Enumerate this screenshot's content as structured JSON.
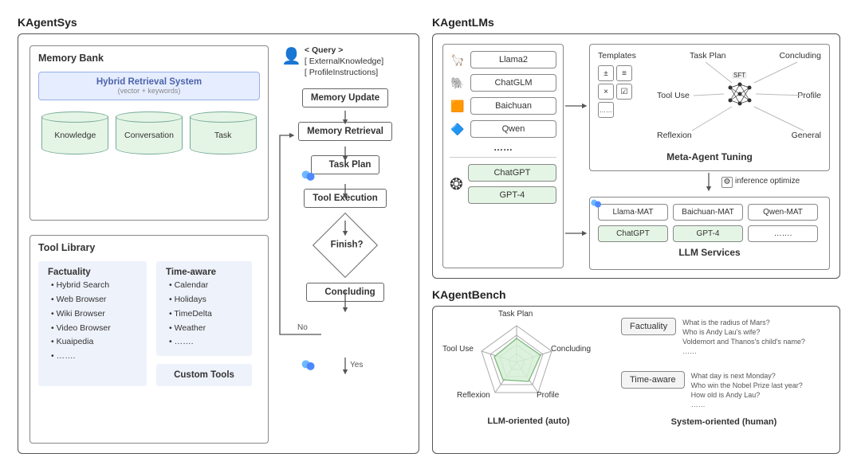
{
  "left": {
    "title": "KAgentSys",
    "memory_bank_title": "Memory Bank",
    "hybrid_retrieval_title": "Hybrid Retrieval System",
    "hybrid_retrieval_sub": "(vector + keywords)",
    "cyl1": "Knowledge",
    "cyl2": "Conversation",
    "cyl3": "Task",
    "tool_library_title": "Tool Library",
    "factuality_header": "Factuality",
    "factuality_items": [
      "Hybrid Search",
      "Web Browser",
      "Wiki Browser",
      "Video Browser",
      "Kuaipedia",
      "……."
    ],
    "timeaware_header": "Time-aware",
    "timeaware_items": [
      "Calendar",
      "Holidays",
      "TimeDelta",
      "Weather",
      "……."
    ],
    "custom_tools": "Custom Tools",
    "query": "< Query >",
    "ext_knowledge": "[ ExternalKnowledge]",
    "profile_inst": "[ ProfileInstructions]",
    "flow": {
      "memory_update": "Memory Update",
      "memory_retrieval": "Memory Retrieval",
      "task_plan": "Task Plan",
      "tool_execution": "Tool Execution",
      "finish": "Finish?",
      "no": "No",
      "yes": "Yes",
      "concluding": "Concluding"
    }
  },
  "lms": {
    "title": "KAgentLMs",
    "open_models": [
      "Llama2",
      "ChatGLM",
      "Baichuan",
      "Qwen"
    ],
    "dots": "……",
    "closed_models": [
      "ChatGPT",
      "GPT-4"
    ],
    "tuning": {
      "templates": "Templates",
      "task_plan": "Task Plan",
      "concluding": "Concluding",
      "tool_use": "Tool Use",
      "profile": "Profile",
      "reflexion": "Reflexion",
      "general": "General",
      "sft": "SFT",
      "footer": "Meta-Agent Tuning"
    },
    "inference_note": "inference optimize",
    "services": {
      "items": [
        "Llama-MAT",
        "Baichuan-MAT",
        "Qwen-MAT",
        "ChatGPT",
        "GPT-4",
        "……."
      ],
      "footer": "LLM Services"
    }
  },
  "bench": {
    "title": "KAgentBench",
    "radar_labels": [
      "Task Plan",
      "Concluding",
      "Profile",
      "Reflexion",
      "Tool Use"
    ],
    "left_caption": "LLM-oriented  (auto)",
    "right_caption": "System-oriented  (human)",
    "factuality_label": "Factuality",
    "factuality_q": [
      "What is the radius of Mars?",
      "Who is Andy Lau's wife?",
      "Voldemort and Thanos's child's name?",
      "……"
    ],
    "timeaware_label": "Time-aware",
    "timeaware_q": [
      "What day is next Monday?",
      "Who win the Nobel Prize last year?",
      "How old is Andy Lau?",
      "……"
    ]
  }
}
